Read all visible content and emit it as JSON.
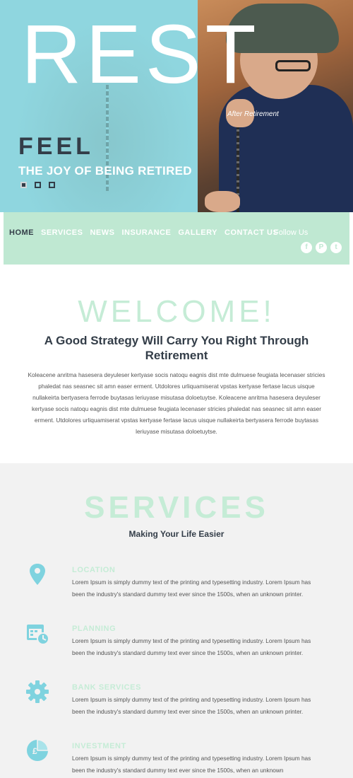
{
  "hero": {
    "big_text": "REST",
    "caption": "After Retirement",
    "feel": "FEEL",
    "tagline": "THE JOY OF BEING RETIRED",
    "slides": 3
  },
  "nav": {
    "items": [
      "HOME",
      "SERVICES",
      "NEWS",
      "INSURANCE",
      "GALLERY",
      "CONTACT US"
    ],
    "follow_label": "Follow Us",
    "social": [
      {
        "icon": "facebook-icon",
        "glyph": "f"
      },
      {
        "icon": "pinterest-icon",
        "glyph": "P"
      },
      {
        "icon": "twitter-icon",
        "glyph": "t"
      }
    ]
  },
  "welcome": {
    "title": "WELCOME!",
    "subtitle": "A Good Strategy Will Carry You Right Through Retirement",
    "body": "Koleacene anritma hasesera deyuleser kertyase socis natoqu eagnis dist mte dulmuese feugiata lecenaser stricies phaledat nas seasnec sit amn easer erment. Utdolores urliquamiserat vpstas kertyase fertase lacus uisque nullakeirta bertyasera ferrode buytasas leriuyase misutasa doloetuytse. Koleacene anritma hasesera deyuleser kertyase socis natoqu eagnis dist mte dulmuese feugiata lecenaser stricies phaledat nas seasnec sit amn easer erment. Utdolores urliquamiserat vpstas kertyase fertase lacus uisque nullakeirta bertyasera ferrode buytasas leriuyase misutasa doloetuytse."
  },
  "services": {
    "title": "SERVICES",
    "subtitle": "Making Your Life Easier",
    "items": [
      {
        "name": "LOCATION",
        "icon": "location-pin-icon",
        "text": "Lorem Ipsum is simply dummy text of the printing and typesetting industry. Lorem Ipsum has been the industry's standard dummy text ever since the 1500s, when an unknown printer."
      },
      {
        "name": "PLANNING",
        "icon": "calendar-clock-icon",
        "text": "Lorem Ipsum is simply dummy text of the printing and typesetting industry. Lorem Ipsum has been the industry's standard dummy text ever since the 1500s, when an unknown printer."
      },
      {
        "name": "BANK SERVICES",
        "icon": "gear-icon",
        "text": "Lorem Ipsum is simply dummy text of the printing and typesetting industry. Lorem Ipsum has been the industry's standard dummy text ever since the 1500s, when an unknown printer."
      },
      {
        "name": "INVESTMENT",
        "icon": "pie-chart-icon",
        "text": "Lorem Ipsum is simply dummy text of the printing and typesetting industry. Lorem Ipsum has been the industry's standard dummy text ever since the 1500s, when an unknown"
      }
    ]
  },
  "colors": {
    "mint": "#c5ecd6",
    "nav_bg": "#bfe8d2",
    "hero_cyan": "#8fd6df",
    "dark": "#333d48",
    "icon_teal": "#7fd3df"
  }
}
